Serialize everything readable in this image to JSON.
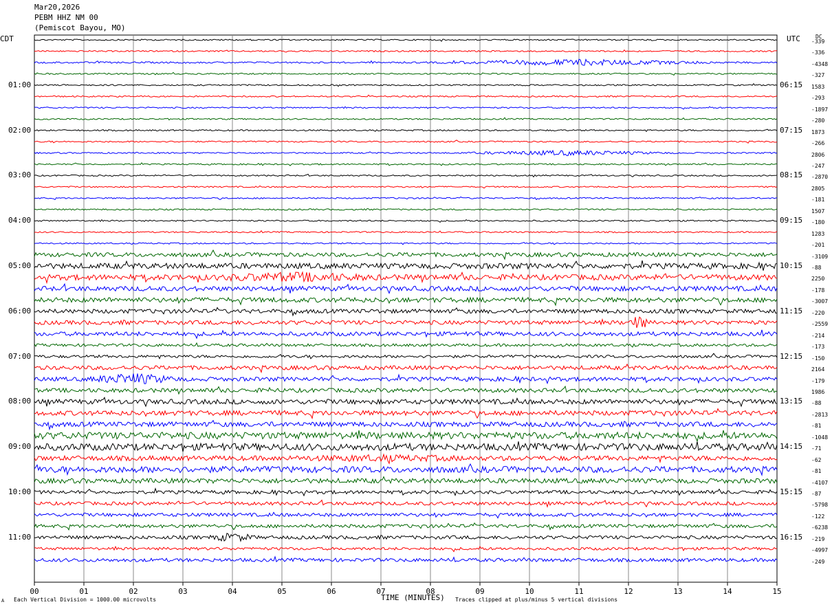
{
  "header": {
    "date": "Mar20,2026",
    "station": "PEBM HHZ NM 00",
    "location": "(Pemiscot Bayou, MO)"
  },
  "chart_data": {
    "type": "line",
    "left_axis_label": "CDT",
    "right_axis_label": "UTC",
    "dc_label": "DC",
    "left_hour_labels": [
      "01:00",
      "02:00",
      "03:00",
      "04:00",
      "05:00",
      "06:00",
      "07:00",
      "08:00",
      "09:00",
      "10:00",
      "11:00"
    ],
    "right_hour_labels": [
      "06:15",
      "07:15",
      "08:15",
      "09:15",
      "10:15",
      "11:15",
      "12:15",
      "13:15",
      "14:15",
      "15:15",
      "16:15"
    ],
    "dc_offsets": [
      "-339",
      "-336",
      "-4348",
      "-327",
      "1583",
      "-293",
      "-1897",
      "-280",
      "1873",
      "-266",
      "2806",
      "-247",
      "-2870",
      "2805",
      "-181",
      "1507",
      "-180",
      "1283",
      "-201",
      "-3109",
      "-88",
      "2250",
      "-178",
      "-3007",
      "-220",
      "-2559",
      "-214",
      "-173",
      "-150",
      "2164",
      "-179",
      "1986",
      "-88",
      "-2813",
      "-81",
      "-1048",
      "-71",
      "-62",
      "-81",
      "-4107",
      "-87",
      "-5798",
      "-122",
      "-6238",
      "-219",
      "-4997",
      "-249"
    ],
    "trace_colors": [
      "#000000",
      "#ff0000",
      "#0000ff",
      "#006600"
    ],
    "x_tick_labels": [
      "00",
      "01",
      "02",
      "03",
      "04",
      "05",
      "06",
      "07",
      "08",
      "09",
      "10",
      "11",
      "12",
      "13",
      "14",
      "15"
    ],
    "xlabel": "TIME (MINUTES)",
    "xlim": [
      0,
      15
    ],
    "trace_amplitudes": [
      1,
      1,
      1.2,
      1,
      1,
      1,
      1,
      1,
      1,
      1,
      1,
      1,
      1,
      1,
      1,
      1,
      1,
      1,
      1,
      3,
      4,
      4,
      3.5,
      3.5,
      3,
      3,
      3,
      2,
      2,
      3,
      3,
      3,
      3.5,
      3.5,
      3.5,
      5,
      5,
      3.5,
      4.5,
      3.5,
      2.5,
      2.5,
      2.5,
      2.5,
      2.5,
      2,
      2.5
    ],
    "bursts": [
      {
        "trace": 2,
        "start": 8,
        "end": 14,
        "gain": 4
      },
      {
        "trace": 10,
        "start": 8.5,
        "end": 13,
        "gain": 4
      },
      {
        "trace": 25,
        "start": 12,
        "end": 12.4,
        "gain": 5
      },
      {
        "trace": 30,
        "start": 1,
        "end": 3,
        "gain": 3
      },
      {
        "trace": 21,
        "start": 3.5,
        "end": 7,
        "gain": 2
      },
      {
        "trace": 37,
        "start": 5,
        "end": 9,
        "gain": 1.6
      },
      {
        "trace": 44,
        "start": 3.5,
        "end": 4.5,
        "gain": 3
      }
    ]
  },
  "footer": {
    "scale_note": "Each Vertical Division = 1000.00 microvolts",
    "clip_note": "Traces clipped at plus/minus 5 vertical divisions",
    "corner_mark": "A"
  }
}
